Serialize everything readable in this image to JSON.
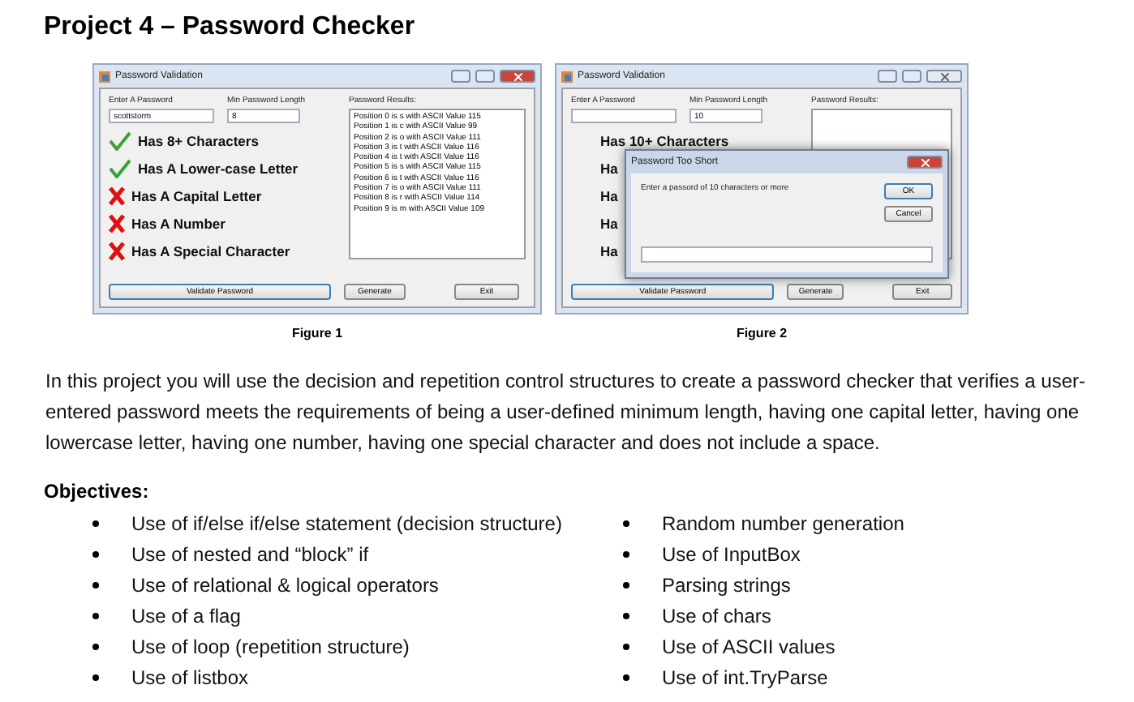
{
  "title": "Project 4 – Password Checker",
  "figures": [
    {
      "caption": "Figure 1",
      "window": {
        "title": "Password Validation",
        "active": true,
        "password_label": "Enter A Password",
        "password_value": "scottstorm",
        "min_label": "Min Password Length",
        "min_value": "8",
        "results_label": "Password Results:",
        "results": [
          "Position 0 is s with ASCII Value 115",
          "Position 1 is c with ASCII Value 99",
          "Position 2 is o with ASCII Value 111",
          "Position 3 is t with ASCII Value 116",
          "Position 4 is t with ASCII Value 116",
          "Position 5 is s with ASCII Value 115",
          "Position 6 is t with ASCII Value 116",
          "Position 7 is o with ASCII Value 111",
          "Position 8 is r with ASCII Value 114",
          "Position 9 is m with ASCII Value 109"
        ],
        "criteria": [
          {
            "text": "Has 8+ Characters",
            "passed": true
          },
          {
            "text": "Has A Lower-case Letter",
            "passed": true
          },
          {
            "text": "Has A Capital Letter",
            "passed": false
          },
          {
            "text": "Has A Number",
            "passed": false
          },
          {
            "text": "Has A Special Character",
            "passed": false
          }
        ],
        "buttons": [
          "Validate Password",
          "Generate",
          "Exit"
        ]
      }
    },
    {
      "caption": "Figure 2",
      "window": {
        "title": "Password Validation",
        "active": false,
        "password_label": "Enter A Password",
        "min_label": "Min Password Length",
        "min_value": "10",
        "results_label": "Password Results:",
        "criteria": [
          {
            "text": "Has 10+ Characters"
          },
          {
            "text": "Ha"
          },
          {
            "text": "Ha"
          },
          {
            "text": "Ha"
          },
          {
            "text": "Ha"
          }
        ],
        "buttons": [
          "Validate Password",
          "Generate",
          "Exit"
        ],
        "dialog": {
          "title": "Password Too Short",
          "message": "Enter a passord of 10 characters or more",
          "buttons": [
            "OK",
            "Cancel"
          ]
        }
      }
    }
  ],
  "paragraph": "In this project you will use the decision and repetition control structures to create a password checker that verifies a user-entered password meets the requirements of being a user-defined minimum length, having one capital letter, having one lowercase letter, having one number, having one special character and  does not include a space.",
  "objectives_heading": "Objectives:",
  "objectives_left": [
    "Use of if/else if/else statement (decision structure)",
    "Use of nested and “block” if",
    "Use of relational & logical operators",
    "Use of a flag",
    "Use of loop (repetition structure)",
    "Use of listbox"
  ],
  "objectives_right": [
    "Random number generation",
    "Use of InputBox",
    "Parsing strings",
    "Use of chars",
    "Use of ASCII values",
    "Use of int.TryParse"
  ]
}
